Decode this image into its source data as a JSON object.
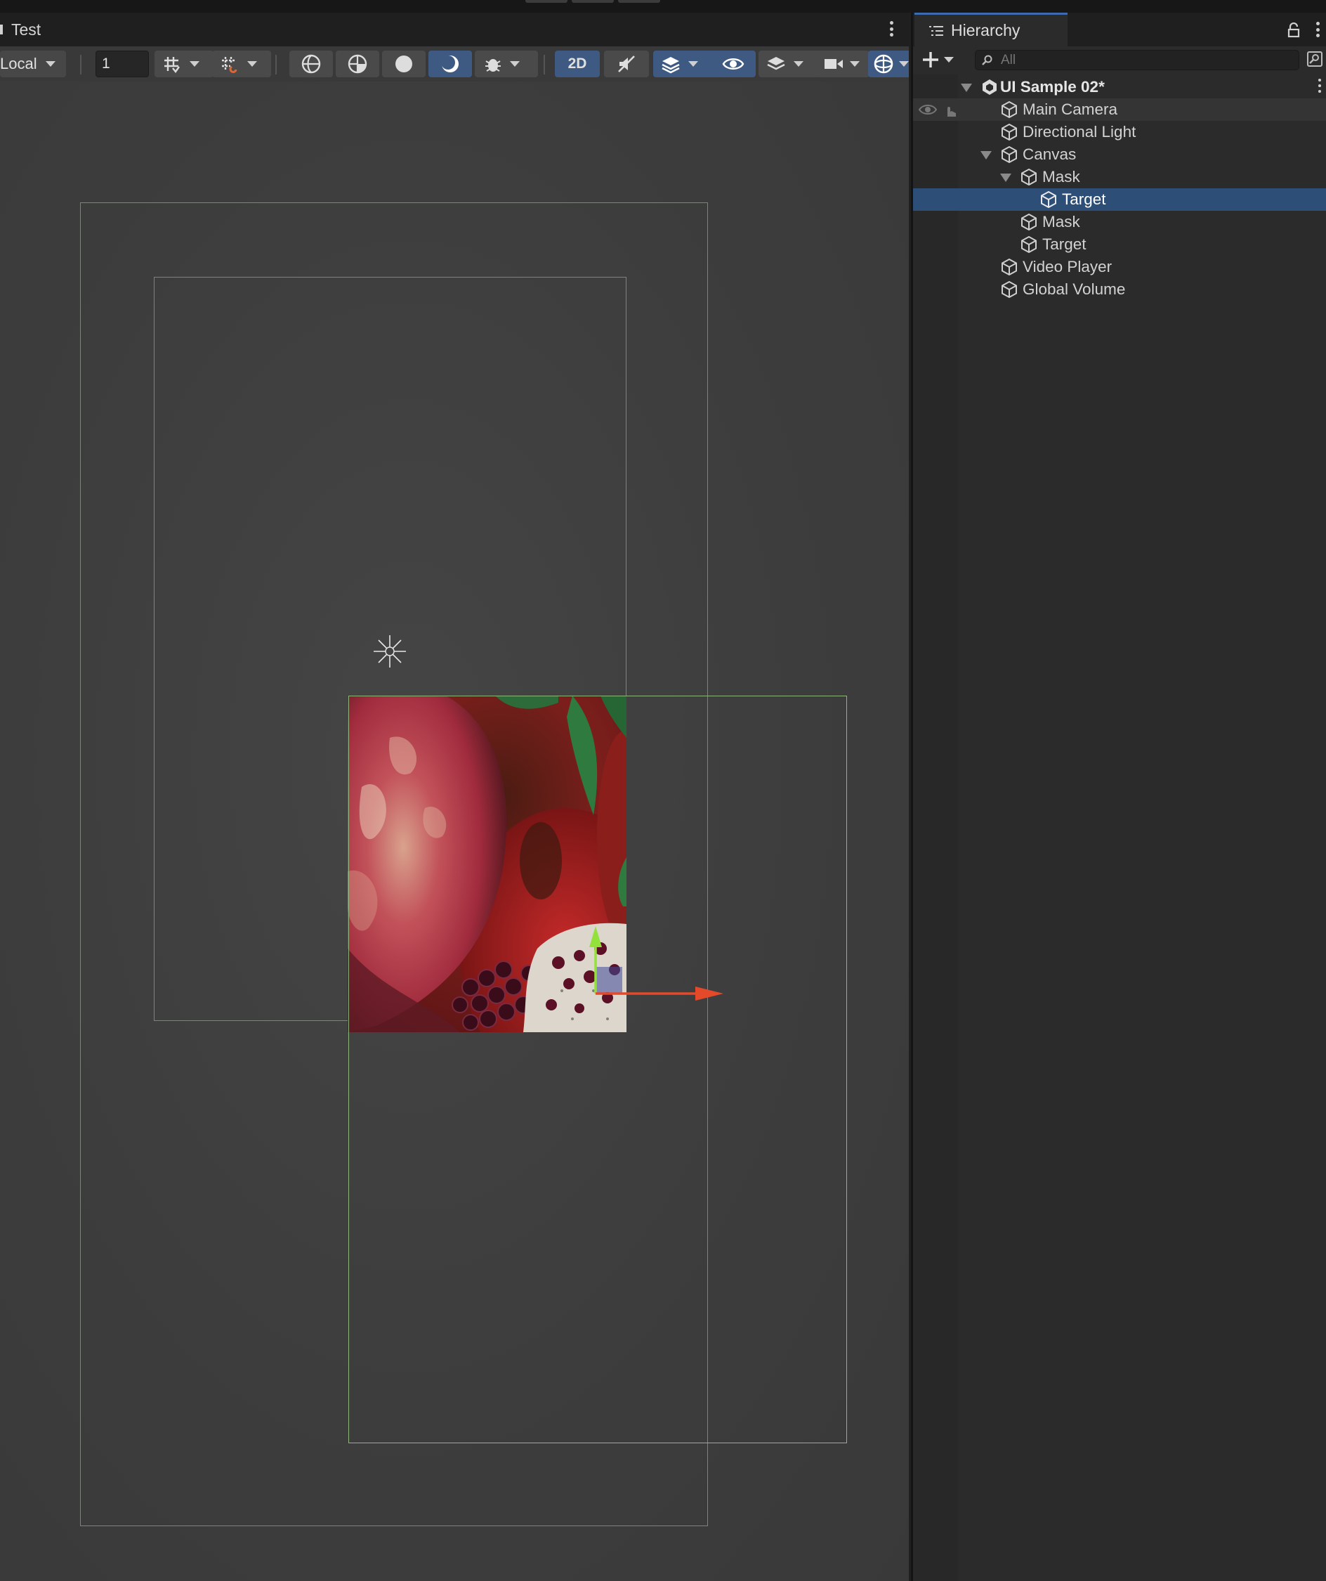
{
  "scene_view": {
    "tab_title": "Test",
    "toolbar": {
      "pivot_rotation": "Local",
      "grid_value": "1",
      "mode_2d": "2D"
    }
  },
  "hierarchy": {
    "tab_title": "Hierarchy",
    "search_placeholder": "All",
    "items": [
      {
        "label": "UI Sample 02*",
        "type": "scene"
      },
      {
        "label": "Main Camera"
      },
      {
        "label": "Directional Light"
      },
      {
        "label": "Canvas"
      },
      {
        "label": "Mask"
      },
      {
        "label": "Target",
        "selected": true
      },
      {
        "label": "Mask"
      },
      {
        "label": "Target"
      },
      {
        "label": "Video Player"
      },
      {
        "label": "Global Volume"
      }
    ]
  },
  "colors": {
    "selection": "#2d4e77",
    "active_button": "#3e5a82",
    "gizmo_x": "#e4492a",
    "gizmo_y": "#93e23b",
    "rect_outline_green": "#8fb57c"
  }
}
